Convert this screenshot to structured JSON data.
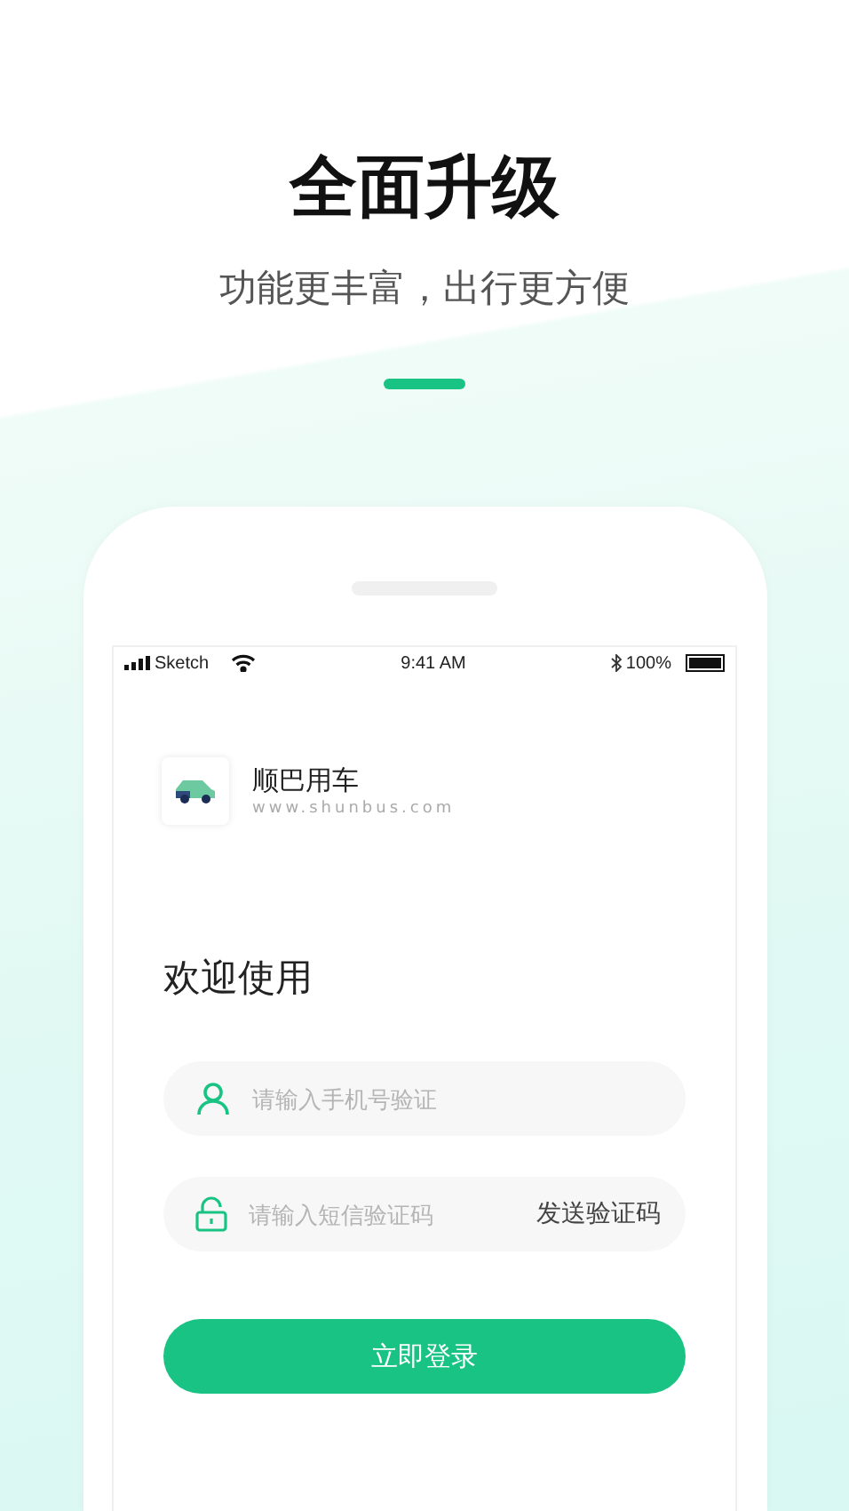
{
  "headline": "全面升级",
  "subtitle": "功能更丰富，出行更方便",
  "status_bar": {
    "carrier": "Sketch",
    "time": "9:41 AM",
    "battery": "100%"
  },
  "app": {
    "name": "顺巴用车",
    "url": "www.shunbus.com"
  },
  "welcome": "欢迎使用",
  "fields": [
    {
      "kind": "phone",
      "placeholder": "请输入手机号验证"
    },
    {
      "kind": "code",
      "placeholder": "请输入短信验证码",
      "action": "发送验证码"
    }
  ],
  "login_button": "立即登录"
}
